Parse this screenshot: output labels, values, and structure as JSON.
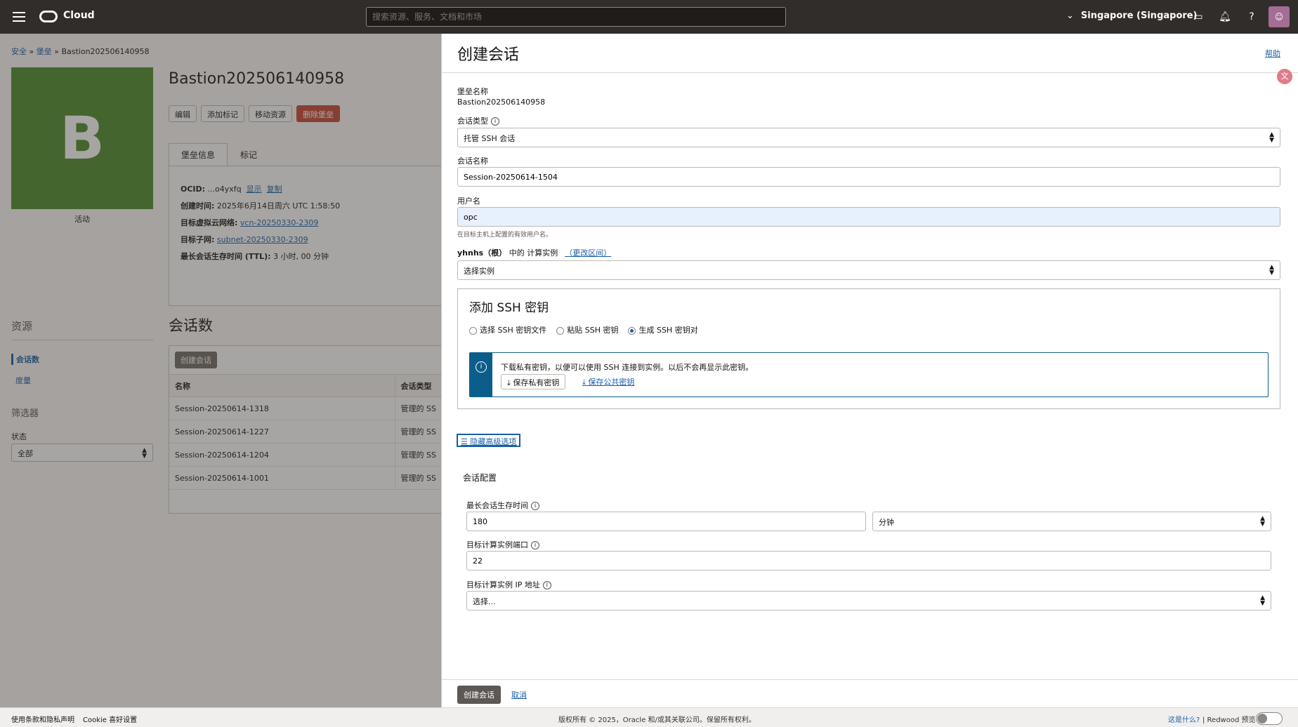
{
  "topbar": {
    "brand": "Cloud",
    "search_placeholder": "搜索资源、服务、文档和市场",
    "region": "Singapore (Singapore)",
    "icons": [
      "menu-icon",
      "oracle-logo-icon",
      "chevron-down-icon",
      "cloud-shell-icon",
      "bell-icon",
      "help-icon",
      "user-icon"
    ]
  },
  "breadcrumb": {
    "items": [
      "安全",
      "堡垒"
    ],
    "sep": "»",
    "current": "Bastion202506140958"
  },
  "bastion": {
    "letter": "B",
    "status": "活动",
    "title": "Bastion202506140958",
    "status_color": "#4c8a29",
    "buttons": [
      "编辑",
      "添加标记",
      "移动资源",
      "删除堡垒"
    ],
    "tabs": [
      "堡垒信息",
      "标记"
    ],
    "info": {
      "ocid_label": "OCID:",
      "ocid_value": "...o4yxfq",
      "ocid_show": "显示",
      "ocid_copy": "复制",
      "created_label": "创建时间:",
      "created_value": "2025年6月14日周六 UTC 1:58:50",
      "vcn_label": "目标虚拟云网络:",
      "vcn_value": "vcn-20250330-2309",
      "subnet_label": "目标子网:",
      "subnet_value": "subnet-20250330-2309",
      "ttl_label": "最长会话生存时间 (TTL):",
      "ttl_value": "3 小时, 00 分钟"
    }
  },
  "resources": {
    "heading": "资源",
    "items": [
      "会话数",
      "度量"
    ]
  },
  "filters": {
    "heading": "筛选器",
    "state_label": "状态",
    "state_value": "全部"
  },
  "sessions": {
    "heading": "会话数",
    "create_button": "创建会话",
    "columns": [
      "名称",
      "会话类型"
    ],
    "rows": [
      [
        "Session-20250614-1318",
        "管理的 SS"
      ],
      [
        "Session-20250614-1227",
        "管理的 SS"
      ],
      [
        "Session-20250614-1204",
        "管理的 SS"
      ],
      [
        "Session-20250614-1001",
        "管理的 SS"
      ]
    ]
  },
  "panel": {
    "title": "创建会话",
    "help": "帮助",
    "bastion_name_label": "堡垒名称",
    "bastion_name_value": "Bastion202506140958",
    "session_type_label": "会话类型",
    "session_type_value": "托管 SSH 会话",
    "session_name_label": "会话名称",
    "session_name_value": "Session-20250614-1504",
    "username_label": "用户名",
    "username_value": "opc",
    "username_hint": "在目标主机上配置的有效用户名。",
    "compartment_bold": "yhnhs（根）",
    "compartment_text": "中的 计算实例",
    "compartment_link": "（更改区间）",
    "instance_placeholder": "选择实例",
    "ssh": {
      "heading": "添加 SSH 密钥",
      "options": [
        "选择 SSH 密钥文件",
        "粘贴 SSH 密钥",
        "生成 SSH 密钥对"
      ],
      "selected_index": 2,
      "notice": "下载私有密钥，以便可以使用 SSH 连接到实例。以后不会再显示此密钥。",
      "save_private": "保存私有密钥",
      "save_public": "保存公共密钥"
    },
    "advanced_toggle": "隐藏高级选项",
    "config_heading": "会话配置",
    "ttl_label": "最长会话生存时间",
    "ttl_value": "180",
    "ttl_unit": "分钟",
    "port_label": "目标计算实例端口",
    "port_value": "22",
    "ip_label": "目标计算实例 IP 地址",
    "ip_placeholder": "选择...",
    "create_button": "创建会话",
    "cancel": "取消"
  },
  "footer": {
    "terms": "使用条款和隐私声明",
    "cookie": "Cookie 喜好设置",
    "copyright": "版权所有 © 2025，Oracle 和/或其关联公司。保留所有权利。",
    "whats_this": "这是什么?",
    "redwood": "| Redwood 预览"
  },
  "colors": {
    "topbar": "#312d2a",
    "accent": "#1a5ea8",
    "danger": "#c74634",
    "notice": "#0c5e8a"
  }
}
